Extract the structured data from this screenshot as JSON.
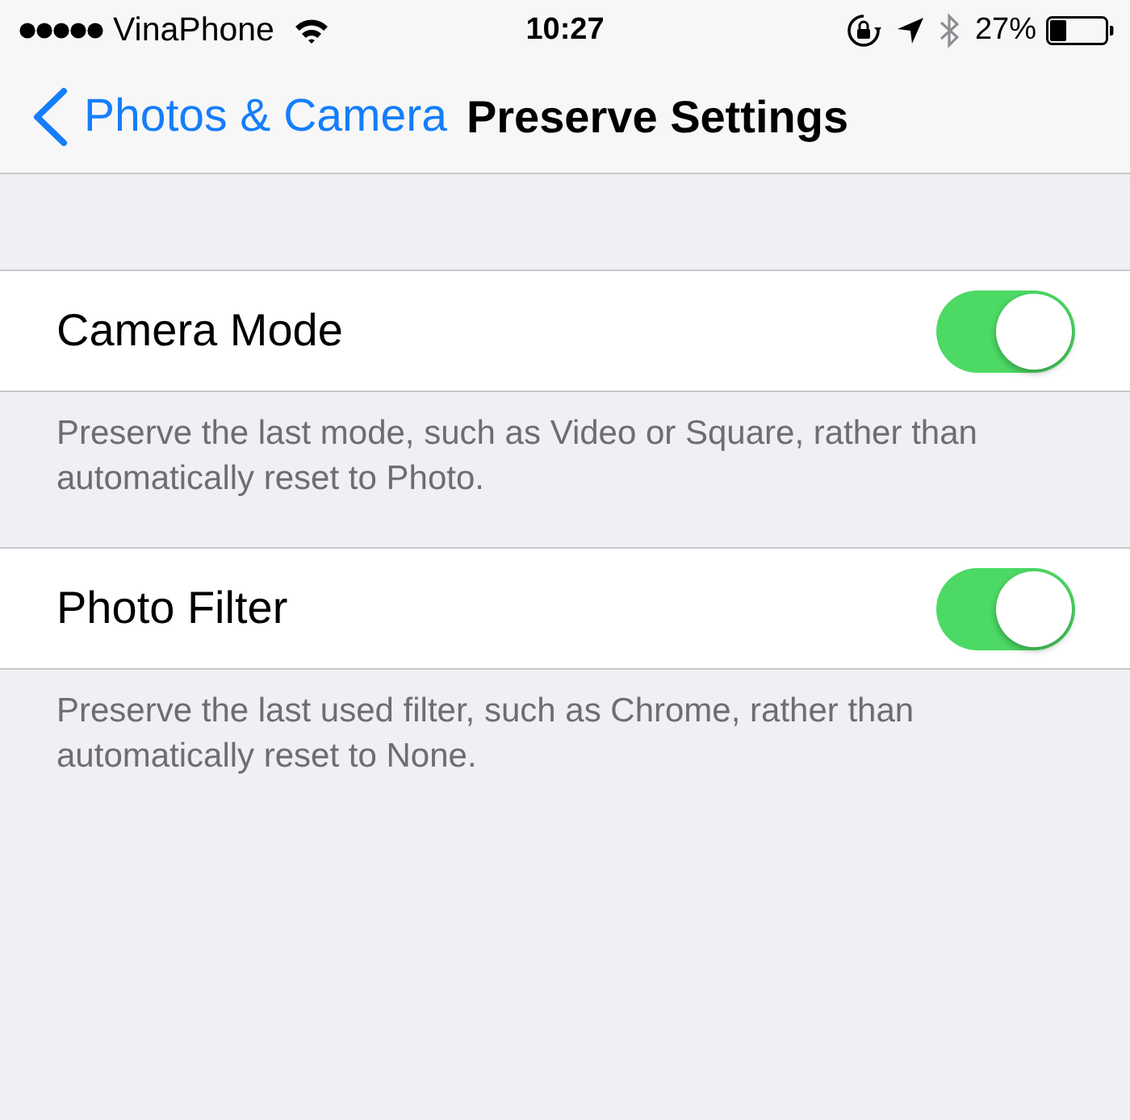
{
  "status_bar": {
    "carrier": "VinaPhone",
    "time": "10:27",
    "battery_text": "27%"
  },
  "nav": {
    "back_label": "Photos & Camera",
    "title": "Preserve Settings"
  },
  "sections": [
    {
      "label": "Camera Mode",
      "on": true,
      "footer": "Preserve the last mode, such as Video or Square, rather than automatically reset to Photo."
    },
    {
      "label": "Photo Filter",
      "on": true,
      "footer": "Preserve the last used filter, such as Chrome, rather than automatically reset to None."
    }
  ]
}
